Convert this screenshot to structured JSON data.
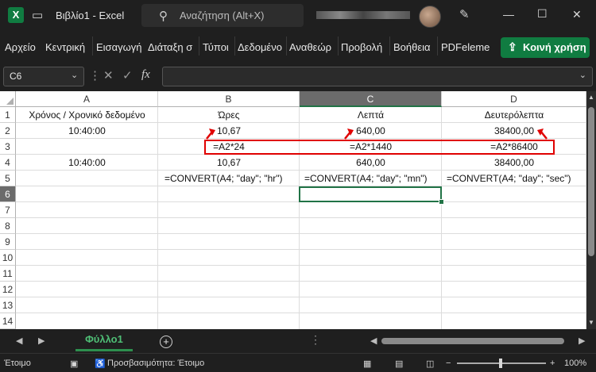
{
  "app": {
    "logo_letter": "X",
    "title": "Βιβλίο1 - Excel",
    "search_placeholder": "Αναζήτηση (Alt+X)"
  },
  "ribbon": {
    "tabs": [
      "Αρχείο",
      "Κεντρική",
      "Εισαγωγή",
      "Διάταξη σ",
      "Τύποι",
      "Δεδομένο",
      "Αναθεώρ",
      "Προβολή",
      "Βοήθεια",
      "PDFeleme"
    ],
    "share_label": "Κοινή χρήση"
  },
  "formula_bar": {
    "name_box": "C6",
    "fx": "fx",
    "formula": ""
  },
  "columns": [
    "A",
    "B",
    "C",
    "D"
  ],
  "selected_column": "C",
  "rows": [
    "1",
    "2",
    "3",
    "4",
    "5",
    "6",
    "7",
    "8",
    "9",
    "10",
    "11",
    "12",
    "13",
    "14"
  ],
  "selected_row": "6",
  "cells": {
    "A1": "Χρόνος / Χρονικό δεδομένο",
    "B1": "Ώρες",
    "C1": "Λεπτά",
    "D1": "Δευτερόλεπτα",
    "A2": "10:40:00",
    "B2": "10,67",
    "C2": "640,00",
    "D2": "38400,00",
    "B3": "=A2*24",
    "C3": "=A2*1440",
    "D3": "=A2*86400",
    "A4": "10:40:00",
    "B4": "10,67",
    "C4": "640,00",
    "D4": "38400,00",
    "B5": "=CONVERT(A4; \"day\"; \"hr\")",
    "C5": "=CONVERT(A4; \"day\"; \"mn\")",
    "D5": "=CONVERT(A4; \"day\"; \"sec\")"
  },
  "sheet_tab": "Φύλλο1",
  "status": {
    "ready": "Έτοιμο",
    "accessibility": "Προσβασιμότητα: Έτοιμο",
    "zoom": "100%"
  },
  "colors": {
    "accent": "#107c41",
    "annotation": "#e00000",
    "selection": "#217346"
  }
}
